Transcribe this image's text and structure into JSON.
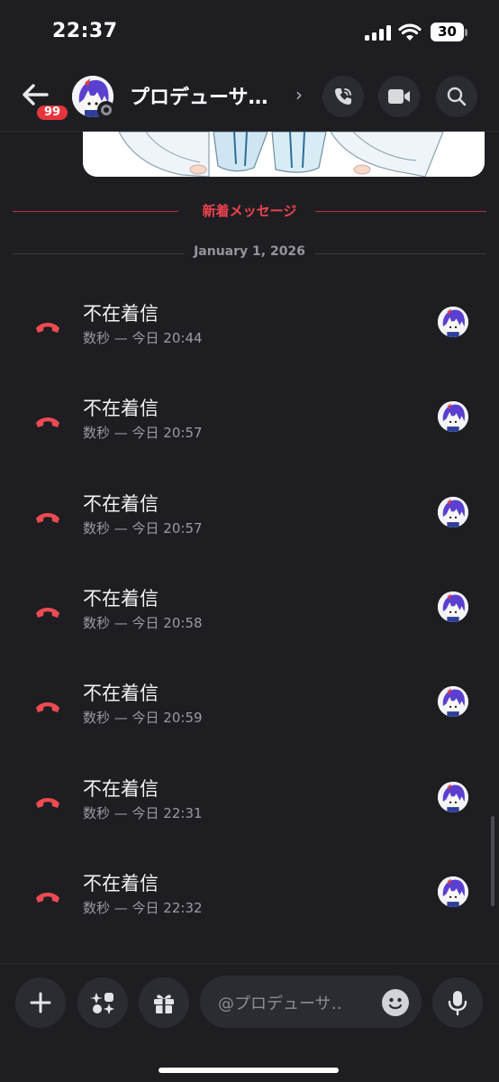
{
  "status_bar": {
    "time": "22:37",
    "battery": "30"
  },
  "header": {
    "badge_count": "99",
    "channel_name": "プロデューサ…",
    "chevron": "›",
    "icons": [
      "back-arrow-icon",
      "phone-call-icon",
      "video-camera-icon",
      "search-icon"
    ]
  },
  "dividers": {
    "new_messages": "新着メッセージ",
    "date": "January 1, 2026"
  },
  "calls": [
    {
      "title": "不在着信",
      "subtitle": "数秒 — 今日 20:44"
    },
    {
      "title": "不在着信",
      "subtitle": "数秒 — 今日 20:57"
    },
    {
      "title": "不在着信",
      "subtitle": "数秒 — 今日 20:57"
    },
    {
      "title": "不在着信",
      "subtitle": "数秒 — 今日 20:58"
    },
    {
      "title": "不在着信",
      "subtitle": "数秒 — 今日 20:59"
    },
    {
      "title": "不在着信",
      "subtitle": "数秒 — 今日 22:31"
    },
    {
      "title": "不在着信",
      "subtitle": "数秒 — 今日 22:32"
    }
  ],
  "composer": {
    "placeholder": "@プロデューサ‥",
    "icons": [
      "plus-icon",
      "apps-icon",
      "gift-icon",
      "emoji-icon",
      "microphone-icon"
    ]
  },
  "colors": {
    "background": "#1e1e22",
    "missed_call_red": "#ee4a52",
    "new_divider_red": "#f0434e",
    "button_bg": "#2b2c31"
  }
}
